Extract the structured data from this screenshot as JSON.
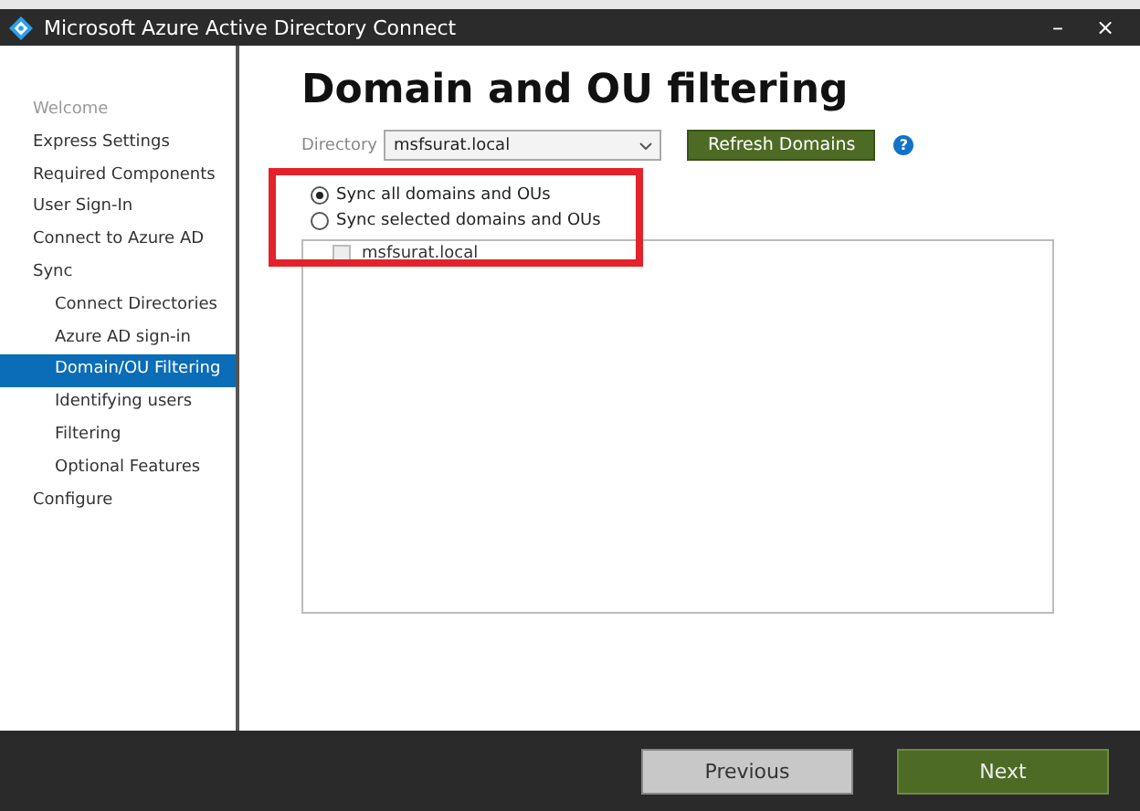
{
  "window": {
    "title": "Microsoft Azure Active Directory Connect",
    "buttons": [
      "–",
      "×"
    ]
  },
  "sidebar": {
    "items": [
      {
        "label": "Welcome",
        "selected": false,
        "disabled": true
      },
      {
        "label": "Express Settings",
        "selected": false,
        "disabled": false
      },
      {
        "label": "Required Components",
        "selected": false,
        "disabled": false
      },
      {
        "label": "User Sign-In",
        "selected": false,
        "disabled": false
      },
      {
        "label": "Connect to Azure AD",
        "selected": false,
        "disabled": false
      },
      {
        "label": "Sync",
        "selected": false,
        "disabled": false,
        "children": [
          {
            "label": "Connect Directories",
            "selected": false,
            "disabled": false
          },
          {
            "label": "Azure AD sign-in",
            "selected": false,
            "disabled": false
          },
          {
            "label": "Domain/OU Filtering",
            "selected": true,
            "disabled": false
          },
          {
            "label": "Identifying users",
            "selected": false,
            "disabled": false
          },
          {
            "label": "Filtering",
            "selected": false,
            "disabled": false
          },
          {
            "label": "Optional Features",
            "selected": false,
            "disabled": false
          }
        ]
      },
      {
        "label": "Configure",
        "selected": false,
        "disabled": false
      }
    ]
  },
  "page": {
    "heading": "Domain and OU filtering",
    "directory": {
      "label": "Directory",
      "value": "msfsurat.local"
    },
    "refresh_button": "Refresh Domains",
    "help": "?",
    "options": [
      {
        "label": "Sync all domains and OUs",
        "selected": true
      },
      {
        "label": "Sync selected domains and OUs",
        "selected": false
      }
    ],
    "tree": [
      {
        "label": "msfsurat.local",
        "checked": false
      }
    ]
  },
  "footer": {
    "buttons": [
      {
        "label": "Previous",
        "kind": "secondary"
      },
      {
        "label": "Next",
        "kind": "primary"
      }
    ]
  }
}
